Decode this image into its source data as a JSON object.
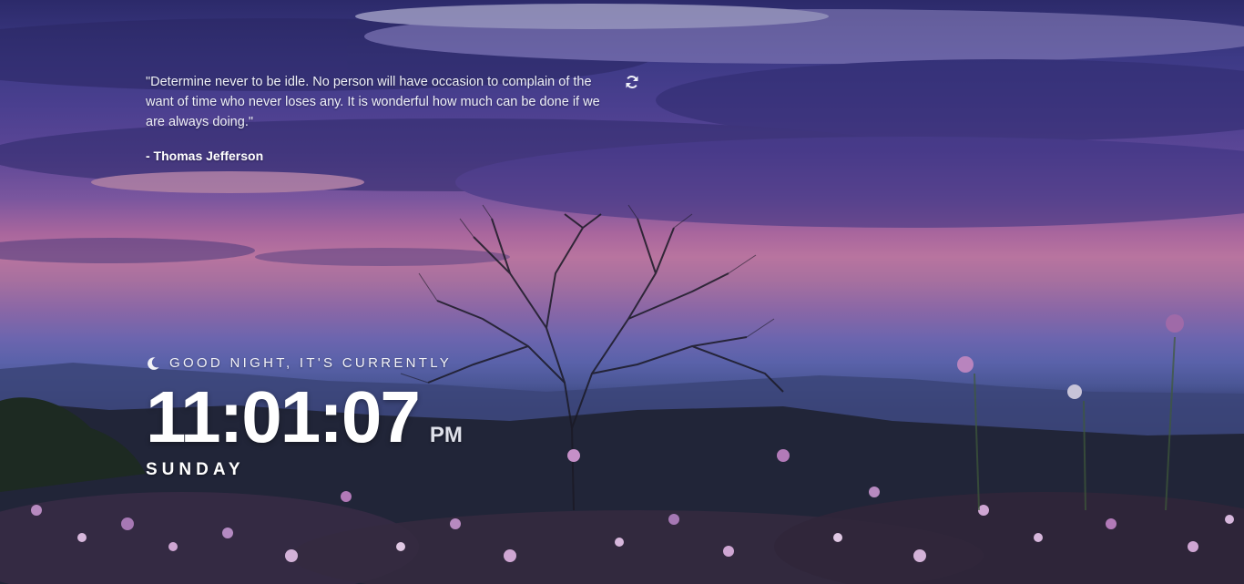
{
  "quote": {
    "text": "\"Determine never to be idle. No person will have occasion to complain of the want of time who never loses any. It is wonderful how much can be done if we are always doing.\"",
    "author": "- Thomas Jefferson"
  },
  "icons": {
    "refresh": "refresh-icon",
    "moon": "moon-icon"
  },
  "greeting": "GOOD NIGHT, IT'S CURRENTLY",
  "clock": {
    "time": "11:01:07",
    "period": "PM",
    "day": "SUNDAY"
  },
  "colors": {
    "text": "#ffffff",
    "sky_top": "#2c2a6a",
    "horizon_pink": "#b8749f"
  }
}
